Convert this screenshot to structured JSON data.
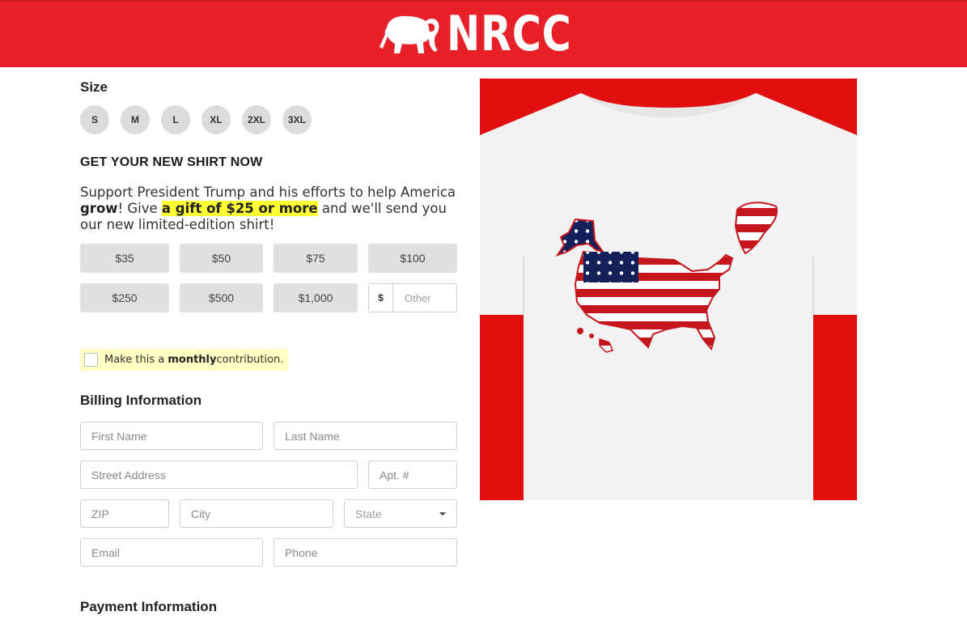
{
  "header": {
    "logo_text": "NRCC",
    "logo_icon": "elephant-icon",
    "bg_color": "#e8202a"
  },
  "size": {
    "heading": "Size",
    "options": [
      "S",
      "M",
      "L",
      "XL",
      "2XL",
      "3XL"
    ]
  },
  "offer": {
    "heading": "GET YOUR NEW SHIRT NOW",
    "pitch_part1": "Support President Trump and his efforts to help America ",
    "pitch_bold": "grow",
    "pitch_part2": "! Give ",
    "pitch_highlight": "a gift of $25 or more",
    "pitch_part3": " and we'll send you our new limited-edition shirt!"
  },
  "amounts": [
    "$35",
    "$50",
    "$75",
    "$100",
    "$250",
    "$500",
    "$1,000"
  ],
  "other_amount": {
    "prefix": "$",
    "placeholder": "Other",
    "value": ""
  },
  "monthly": {
    "prefix": "Make this a ",
    "bold": "monthly",
    "suffix": " contribution."
  },
  "billing": {
    "heading": "Billing Information",
    "first_name": "First Name",
    "last_name": "Last Name",
    "street": "Street Address",
    "apt": "Apt. #",
    "zip": "ZIP",
    "city": "City",
    "state": "State",
    "email": "Email",
    "phone": "Phone"
  },
  "payment": {
    "heading": "Payment Information"
  },
  "product_image": {
    "icon": "american-flag-map-tshirt",
    "bg_color": "#e10f10"
  }
}
